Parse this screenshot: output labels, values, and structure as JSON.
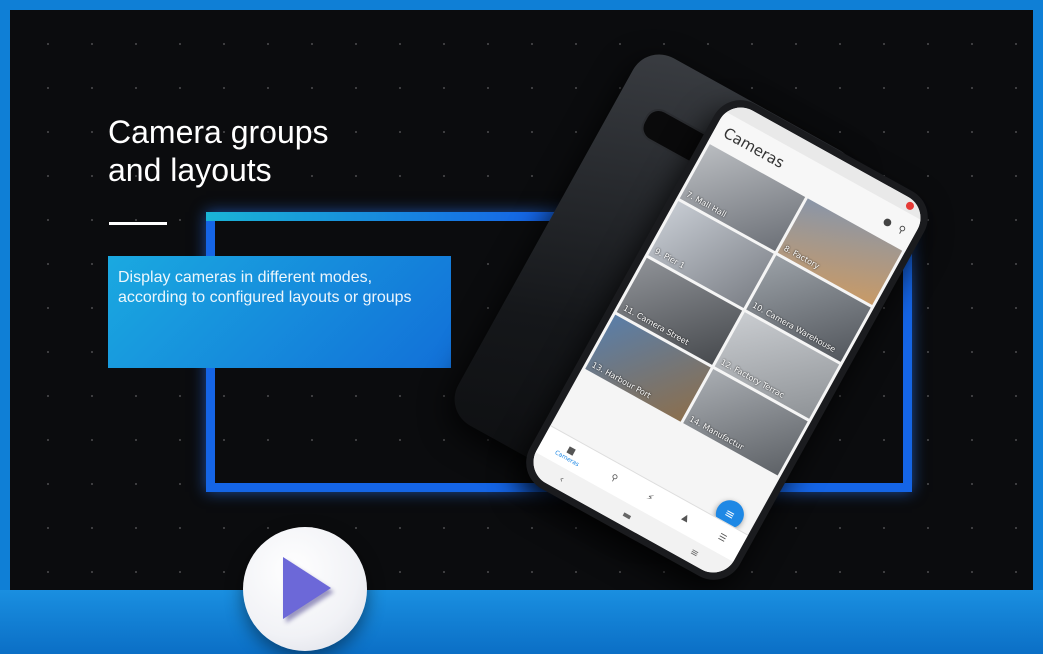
{
  "slide": {
    "title": "Camera groups\nand layouts",
    "description": "Display cameras in different modes,\naccording to configured layouts or groups"
  },
  "phone": {
    "app_title": "Cameras",
    "cameras": [
      {
        "label": "7. Mall Hall"
      },
      {
        "label": "8. Factory"
      },
      {
        "label": "9. Pier 1"
      },
      {
        "label": "10. Camera Warehouse"
      },
      {
        "label": "11. Camera Street"
      },
      {
        "label": "12. Factory Terrac"
      },
      {
        "label": "13. Harbour Port"
      },
      {
        "label": "14. Manufactur"
      }
    ],
    "nav": {
      "cameras_label": "Cameras"
    }
  },
  "colors": {
    "frame_border": "#0f7fd6",
    "accent_blue": "#1565e6",
    "accent_cyan": "#1ab4d6",
    "play_triangle": "#6c68d8",
    "fab": "#1e88e5"
  },
  "icons": {
    "search": "search-icon",
    "play": "play-icon",
    "filter": "filter-icon"
  }
}
